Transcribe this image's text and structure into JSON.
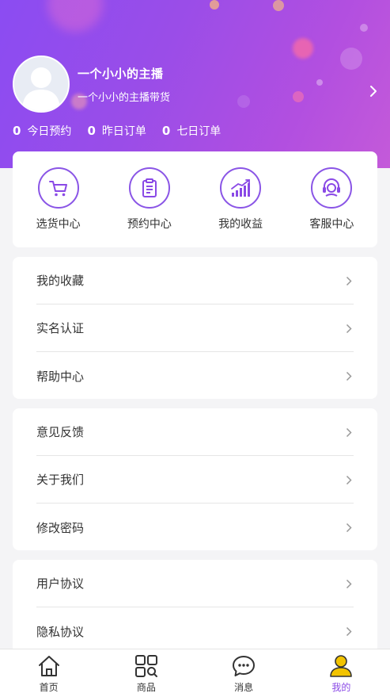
{
  "profile": {
    "name": "一个小小的主播",
    "subtitle": "一个小小的主播带货"
  },
  "stats": [
    {
      "num": "0",
      "label": "今日预约"
    },
    {
      "num": "0",
      "label": "昨日订单"
    },
    {
      "num": "0",
      "label": "七日订单"
    }
  ],
  "quick_actions": [
    {
      "label": "选货中心",
      "icon": "cart-icon"
    },
    {
      "label": "预约中心",
      "icon": "clipboard-icon"
    },
    {
      "label": "我的收益",
      "icon": "earnings-chart-icon"
    },
    {
      "label": "客服中心",
      "icon": "headset-icon"
    }
  ],
  "menu_group_1": [
    "我的收藏",
    "实名认证",
    "帮助中心"
  ],
  "menu_group_2": [
    "意见反馈",
    "关于我们",
    "修改密码"
  ],
  "menu_group_3": [
    "用户协议",
    "隐私协议"
  ],
  "tabbar": [
    {
      "label": "首页",
      "icon": "home-icon"
    },
    {
      "label": "商品",
      "icon": "grid-icon"
    },
    {
      "label": "消息",
      "icon": "message-icon"
    },
    {
      "label": "我的",
      "icon": "user-icon",
      "active": true
    }
  ],
  "colors": {
    "accent": "#8a49e6",
    "header_start": "#8b4cf2",
    "header_end": "#c45ad9"
  }
}
